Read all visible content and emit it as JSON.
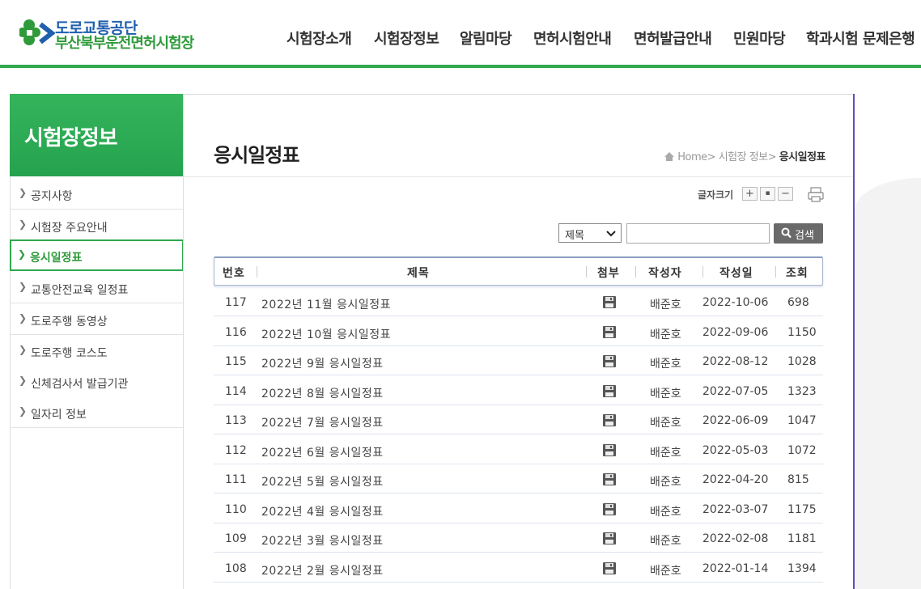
{
  "header": {
    "logo_line1": "도로교통공단",
    "logo_line2": "부산북부운전면허시험장",
    "nav": [
      "시험장소개",
      "시험장정보",
      "알림마당",
      "면허시험안내",
      "면허발급안내",
      "민원마당",
      "학과시험 문제은행"
    ]
  },
  "sidebar": {
    "title": "시험장정보",
    "items": [
      {
        "label": "공지사항"
      },
      {
        "label": "시험장 주요안내"
      },
      {
        "label": "응시일정표"
      },
      {
        "label": "교통안전교육 일정표"
      },
      {
        "label": "도로주행 동영상"
      },
      {
        "label": "도로주행 코스도"
      },
      {
        "label": "신체검사서 발급기관"
      },
      {
        "label": "일자리 정보"
      }
    ],
    "active_index": 2
  },
  "page": {
    "title": "응시일정표",
    "breadcrumb": {
      "home": "Home",
      "sep1": ">",
      "level1": "시험장 정보",
      "sep2": ">",
      "current": "응시일정표"
    },
    "fontsize_label": "글자크기",
    "fontsize_plus": "+",
    "fontsize_reset": "▪",
    "fontsize_minus": "−"
  },
  "search": {
    "select_value": "제목",
    "input_value": "",
    "button_label": "검색"
  },
  "table": {
    "headers": {
      "no": "번호",
      "title": "제목",
      "attach": "첨부",
      "author": "작성자",
      "date": "작성일",
      "views": "조회"
    },
    "rows": [
      {
        "no": "117",
        "title": "2022년 11월 응시일정표",
        "author": "배준호",
        "date": "2022-10-06",
        "views": "698"
      },
      {
        "no": "116",
        "title": "2022년 10월 응시일정표",
        "author": "배준호",
        "date": "2022-09-06",
        "views": "1150"
      },
      {
        "no": "115",
        "title": "2022년 9월 응시일정표",
        "author": "배준호",
        "date": "2022-08-12",
        "views": "1028"
      },
      {
        "no": "114",
        "title": "2022년 8월 응시일정표",
        "author": "배준호",
        "date": "2022-07-05",
        "views": "1323"
      },
      {
        "no": "113",
        "title": "2022년 7월 응시일정표",
        "author": "배준호",
        "date": "2022-06-09",
        "views": "1047"
      },
      {
        "no": "112",
        "title": "2022년 6월 응시일정표",
        "author": "배준호",
        "date": "2022-05-03",
        "views": "1072"
      },
      {
        "no": "111",
        "title": "2022년 5월 응시일정표",
        "author": "배준호",
        "date": "2022-04-20",
        "views": "815"
      },
      {
        "no": "110",
        "title": "2022년 4월 응시일정표",
        "author": "배준호",
        "date": "2022-03-07",
        "views": "1175"
      },
      {
        "no": "109",
        "title": "2022년 3월 응시일정표",
        "author": "배준호",
        "date": "2022-02-08",
        "views": "1181"
      },
      {
        "no": "108",
        "title": "2022년 2월 응시일정표",
        "author": "배준호",
        "date": "2022-01-14",
        "views": "1394"
      }
    ]
  },
  "colors": {
    "brand_green": "#2fa84f",
    "brand_blue": "#1f5fae",
    "right_border": "#5a4fc8"
  }
}
